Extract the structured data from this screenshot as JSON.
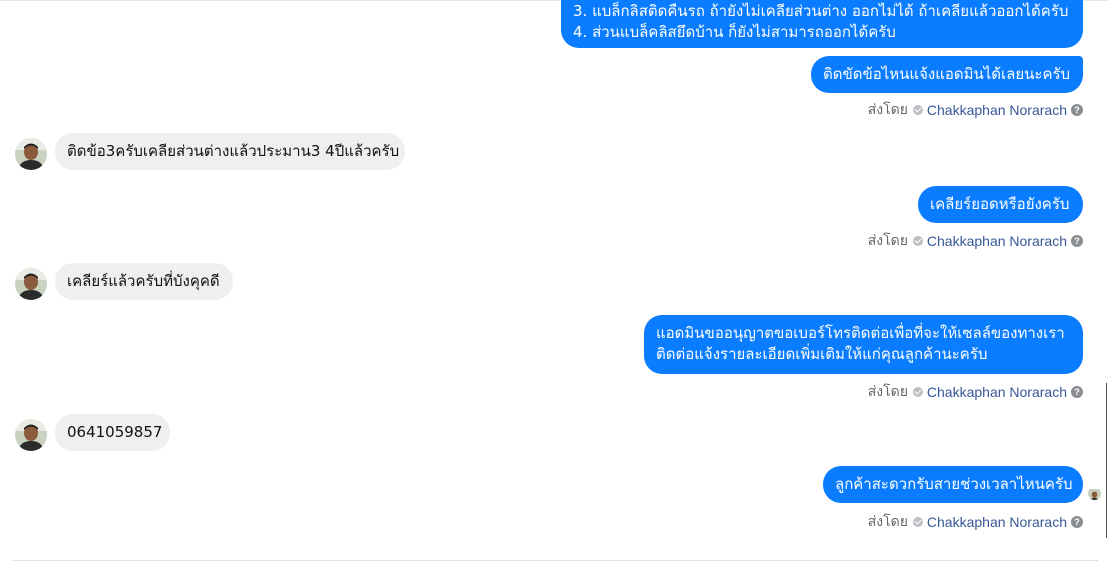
{
  "messages": {
    "m1": {
      "line1": "3. แบล็กลิสติดคืนรถ ถ้ายังไม่เคลียส่วนต่าง ออกไม่ได้ ถ้าเคลียแล้วออกได้ครับ",
      "line2": "4. ส่วนแบล็คลิสยึดบ้าน ก็ยังไม่สามารถออกได้ครับ"
    },
    "m2": "ติดขัดข้อไหนแจ้งแอดมินได้เลยนะครับ",
    "m3": "ติดข้อ3ครับเคลียส่วนต่างแล้วประมาน3 4ปีแล้วครับ",
    "m4": "เคลียร์ยอดหรือยังครับ",
    "m5": "เคลียร์แล้วครับที่บังคุคดี",
    "m6": {
      "line1": "แอดมินขออนุญาตขอเบอร์โทรติดต่อเพื่อที่จะให้เซลล์ของทางเรา",
      "line2": "ติดต่อแจ้งรายละเอียดเพิ่มเติมให้แก่คุณลูกค้านะครับ"
    },
    "m7": "0641059857",
    "m8": "ลูกค้าสะดวกรับสายช่วงเวลาไหนครับ"
  },
  "sent_by": {
    "prefix": "ส่งโดย",
    "name": "Chakkaphan Norarach",
    "help": "?"
  },
  "colors": {
    "outgoing": "#0a7cff",
    "incoming": "#efefef",
    "sender_name": "#385898"
  },
  "icons": {
    "verified": "verified-badge-icon",
    "help": "help-circle-icon"
  }
}
